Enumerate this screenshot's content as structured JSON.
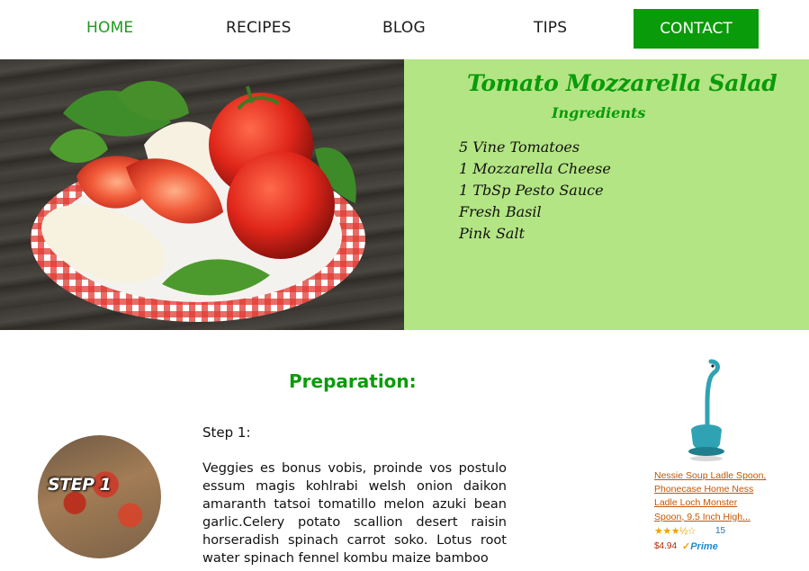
{
  "nav": {
    "items": [
      {
        "label": "HOME",
        "active": true
      },
      {
        "label": "RECIPES",
        "active": false
      },
      {
        "label": "BLOG",
        "active": false
      },
      {
        "label": "TIPS",
        "active": false
      }
    ],
    "contact_label": "CONTACT"
  },
  "recipe": {
    "title": "Tomato Mozzarella Salad",
    "ingredients_heading": "Ingredients",
    "ingredients": [
      "5 Vine Tomatoes",
      "1 Mozzarella Cheese",
      "1 TbSp Pesto Sauce",
      "Fresh Basil",
      "Pink Salt"
    ]
  },
  "preparation": {
    "heading": "Preparation:",
    "step_badge": "STEP 1",
    "step_title": "Step 1:",
    "step_text": "Veggies es bonus vobis, proinde vos postulo essum magis kohlrabi welsh onion daikon amaranth tatsoi tomatillo melon azuki bean garlic.Celery potato scallion desert raisin horseradish spinach carrot soko. Lotus root water spinach fennel kombu maize bamboo"
  },
  "product": {
    "title": "Nessie Soup Ladle Spoon, Phonecase Home Ness Ladle Loch Monster Spoon, 9.5 Inch High...",
    "stars": "★★★½☆",
    "rating_count": "15",
    "price": "$4.94",
    "prime_label": "Prime",
    "prime_check": "✓"
  },
  "colors": {
    "accent_green": "#0a9b0a",
    "panel_green": "#b3e584",
    "link_orange": "#c45500"
  }
}
